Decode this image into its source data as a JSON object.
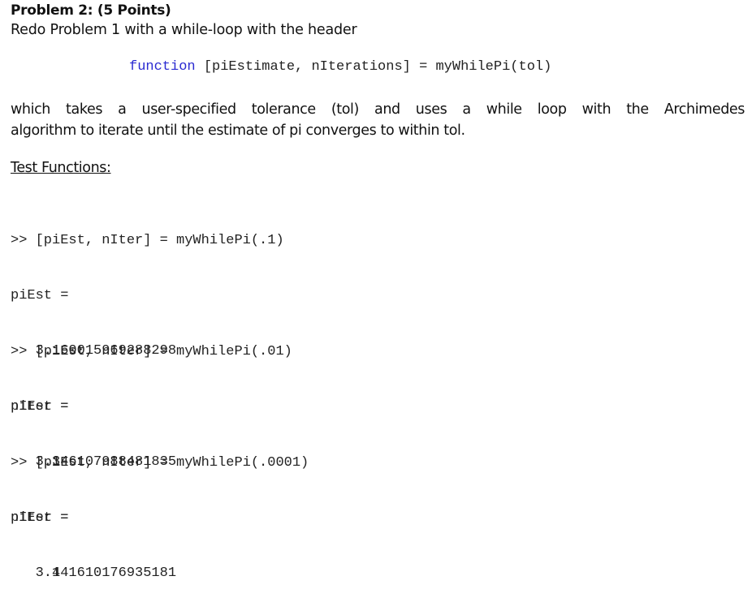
{
  "problem": {
    "title": "Problem 2: (5 Points)",
    "subtitle": "Redo Problem 1 with a while-loop with the header",
    "header_code": {
      "keyword": "function",
      "rest": " [piEstimate, nIterations] = myWhilePi(tol)"
    },
    "description_line1": "which takes a user-specified tolerance (tol) and uses a while loop with the Archimedes",
    "description_line2": "algorithm to iterate until the estimate of pi converges to within tol.",
    "test_heading": "Test Functions:",
    "keyword_color": "#2b2bd1"
  },
  "tests": [
    {
      "command": ">> [piEst, nIter] = myWhilePi(.1)",
      "pi_label": "piEst =",
      "pi_value": "   3.160015969288298",
      "iter_label": "nIter =",
      "iter_value": "     3"
    },
    {
      "command": ">> [piEst, nIter] = myWhilePi(.01)",
      "pi_label": "piEst =",
      "pi_value": "   3.146107988481835",
      "iter_label": "nIter =",
      "iter_value": "     4"
    },
    {
      "command": ">> [piEst, nIter] = myWhilePi(.0001)",
      "pi_label": "piEst =",
      "pi_value": "   3.141610176935181"
    }
  ]
}
